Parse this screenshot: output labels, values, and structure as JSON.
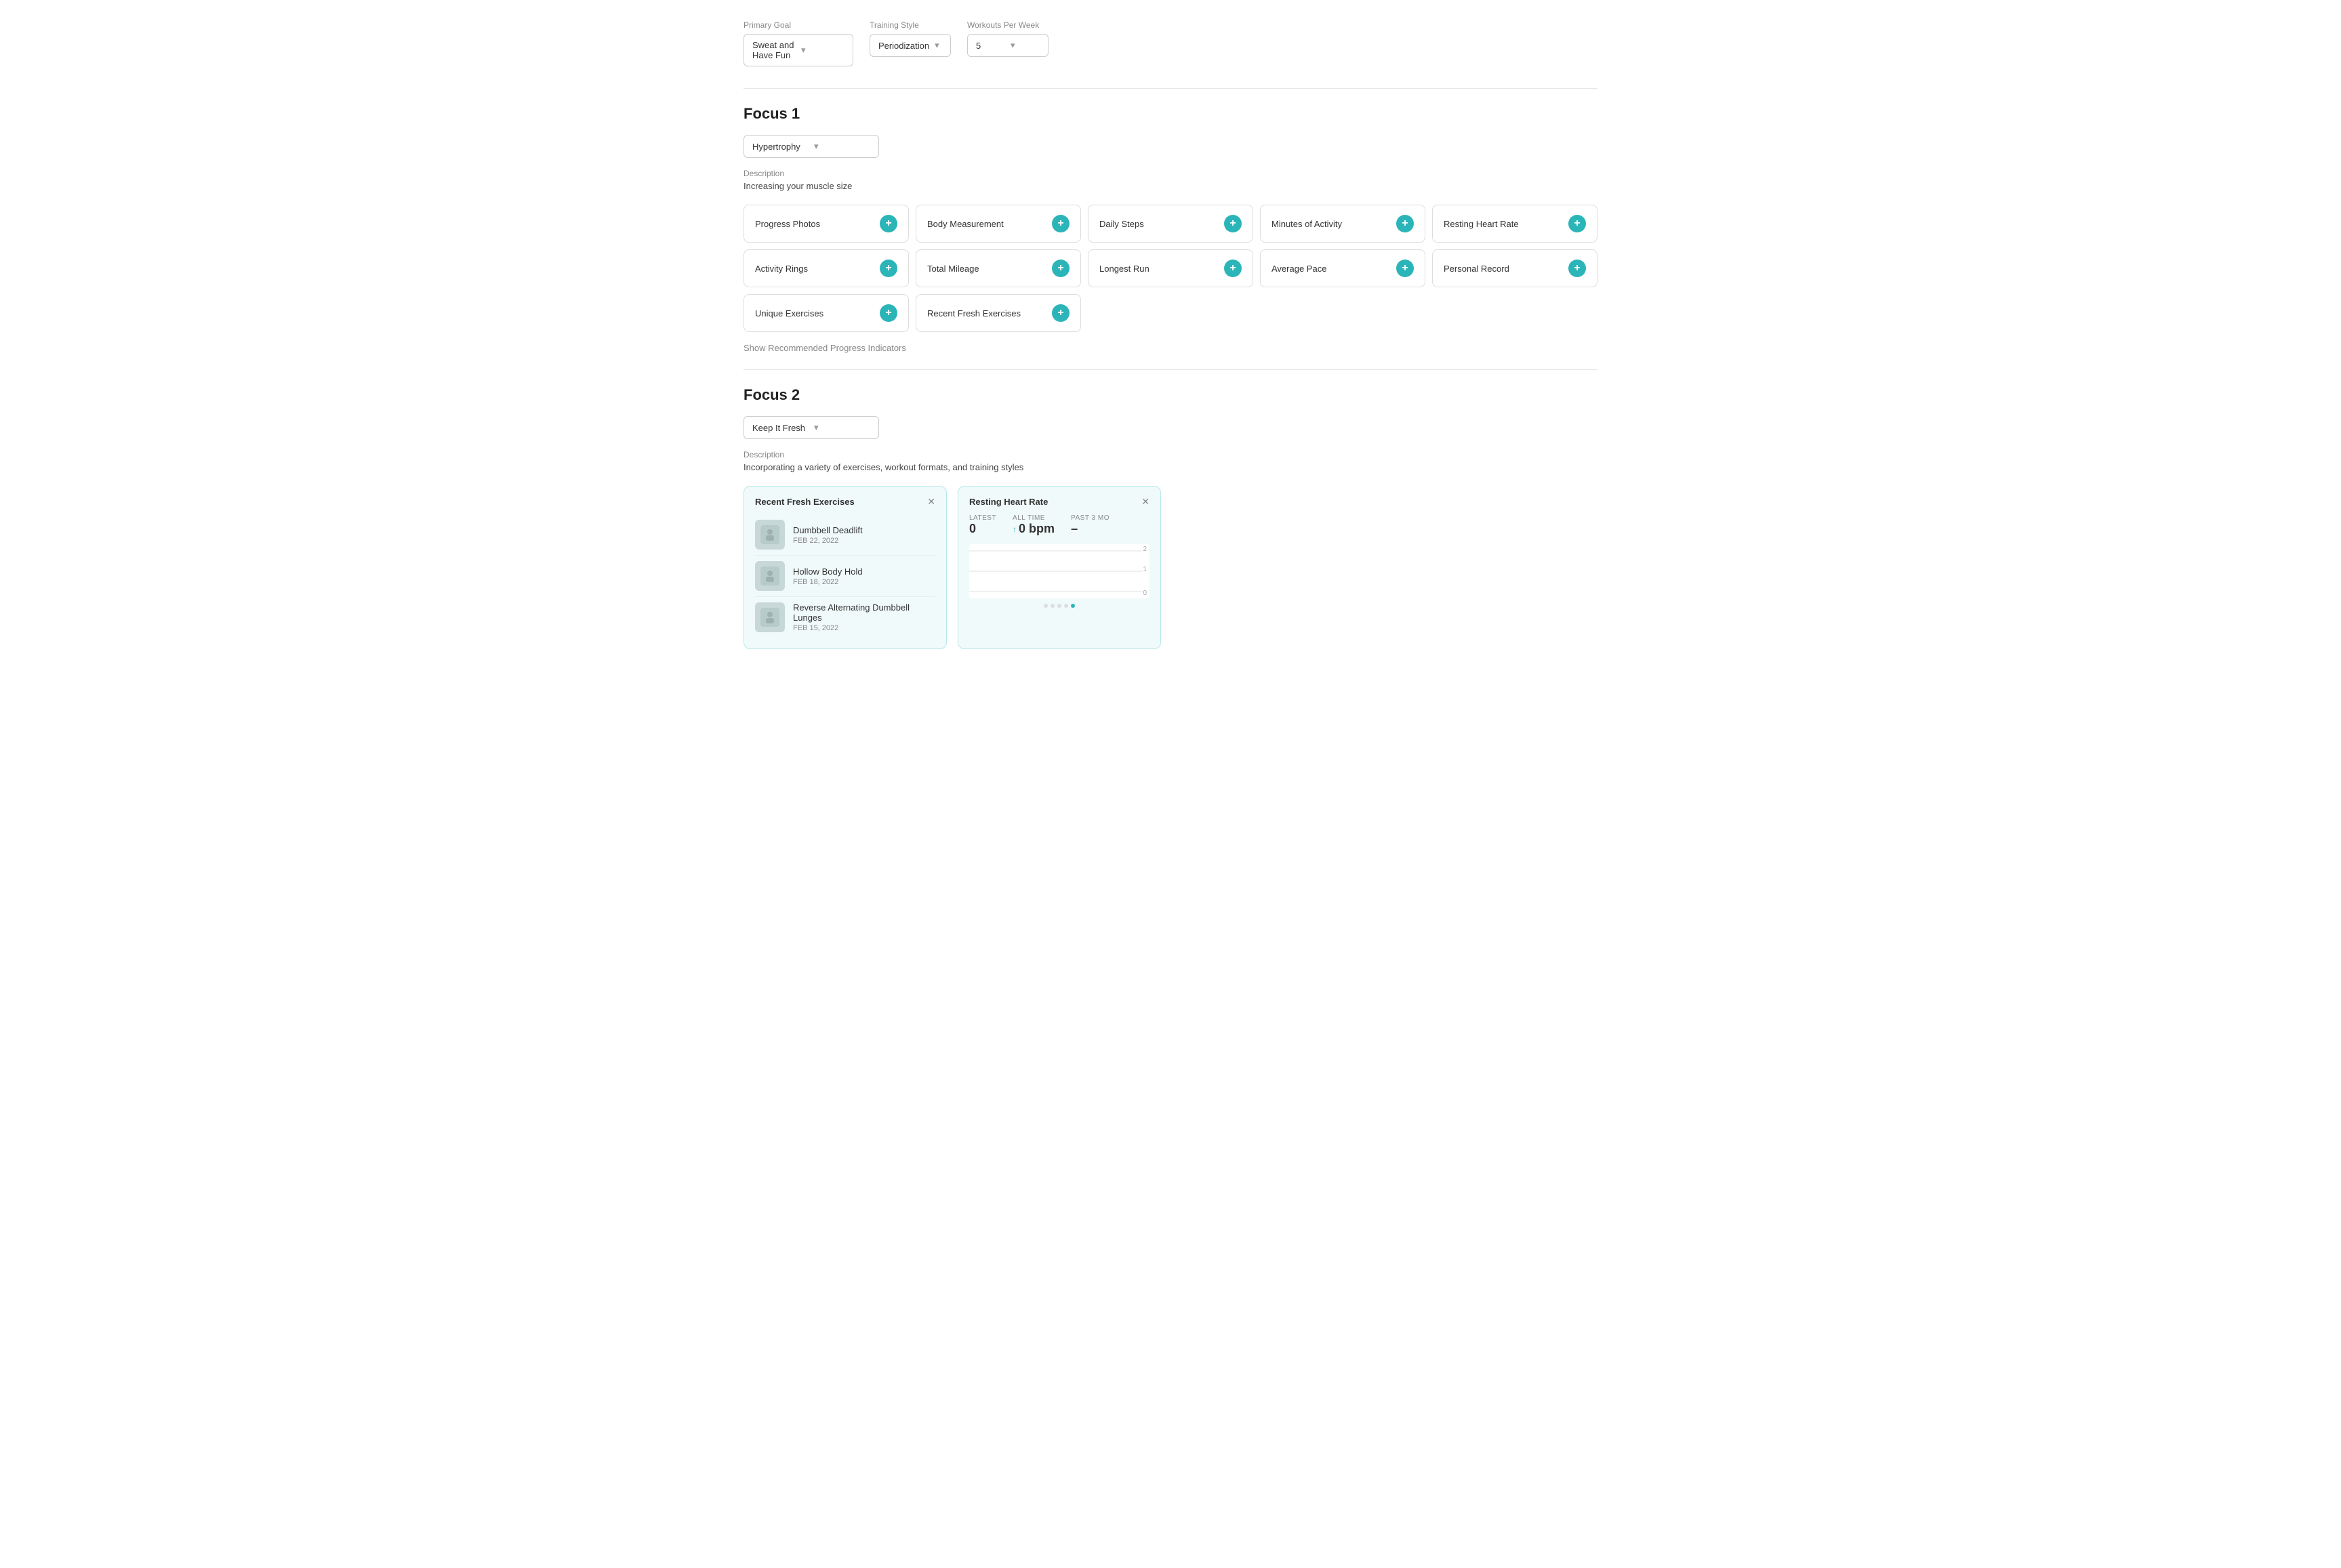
{
  "header": {
    "primary_goal_label": "Primary Goal",
    "primary_goal_value": "Sweat and Have Fun",
    "training_style_label": "Training Style",
    "training_style_value": "Periodization",
    "workouts_per_week_label": "Workouts Per Week",
    "workouts_per_week_value": "5"
  },
  "focus1": {
    "title": "Focus",
    "number": "1",
    "dropdown_value": "Hypertrophy",
    "description_label": "Description",
    "description_text": "Increasing your muscle size",
    "indicators": [
      {
        "label": "Progress Photos"
      },
      {
        "label": "Body Measurement"
      },
      {
        "label": "Daily Steps"
      },
      {
        "label": "Minutes of Activity"
      },
      {
        "label": "Resting Heart Rate"
      },
      {
        "label": "Activity Rings"
      },
      {
        "label": "Total Mileage"
      },
      {
        "label": "Longest Run"
      },
      {
        "label": "Average Pace"
      },
      {
        "label": "Personal Record"
      },
      {
        "label": "Unique Exercises"
      },
      {
        "label": "Recent Fresh Exercises"
      }
    ],
    "show_recommended": "Show Recommended Progress Indicators"
  },
  "focus2": {
    "title": "Focus",
    "number": "2",
    "dropdown_value": "Keep It Fresh",
    "description_label": "Description",
    "description_text": "Incorporating a variety of exercises, workout formats, and training styles",
    "widgets": {
      "recent_exercises": {
        "title": "Recent Fresh Exercises",
        "exercises": [
          {
            "name": "Dumbbell Deadlift",
            "date": "FEB 22, 2022"
          },
          {
            "name": "Hollow Body Hold",
            "date": "FEB 18, 2022"
          },
          {
            "name": "Reverse Alternating Dumbbell Lunges",
            "date": "FEB 15, 2022"
          }
        ]
      },
      "resting_heart_rate": {
        "title": "Resting Heart Rate",
        "latest_label": "LATEST",
        "latest_value": "0",
        "all_time_label": "ALL TIME",
        "all_time_value": "0 bpm",
        "all_time_trend": "↑",
        "past3mo_label": "PAST 3 MO",
        "past3mo_value": "–",
        "chart_y_labels": [
          "2",
          "1",
          "0"
        ]
      }
    }
  }
}
